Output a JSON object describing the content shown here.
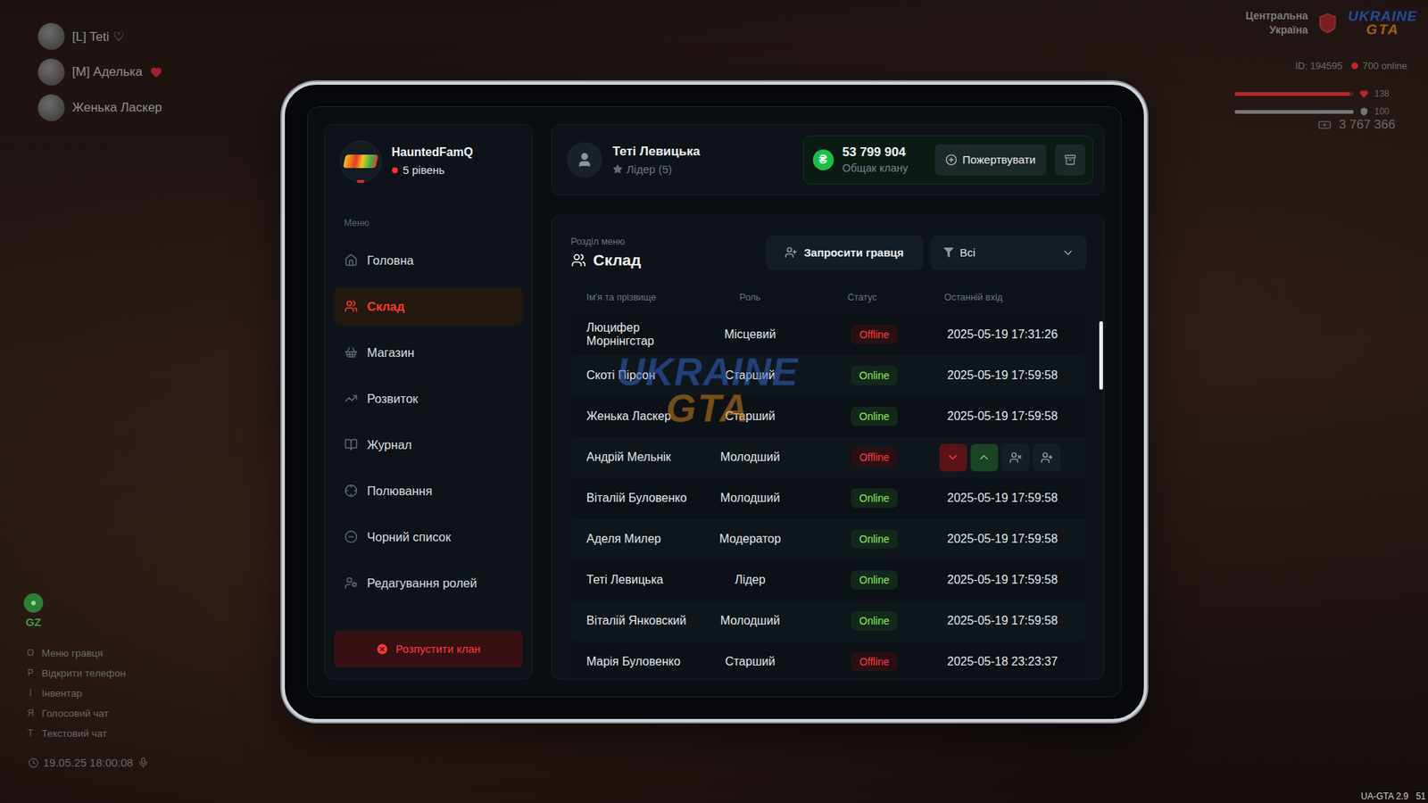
{
  "hud": {
    "players": [
      {
        "name": "[L] Teti",
        "mark": "♡",
        "heart": false
      },
      {
        "name": "[M] Аделька",
        "mark": "",
        "heart": true
      },
      {
        "name": "Женька Ласкер",
        "mark": "",
        "heart": false
      }
    ],
    "region": [
      "Центральна",
      "Україна"
    ],
    "logo": [
      "UKRAINE",
      "GTA"
    ],
    "player_id": "ID: 194595",
    "online": "700 online",
    "bars": [
      {
        "name": "health",
        "value": "138",
        "level": 0.97,
        "color": "#b8252b"
      },
      {
        "name": "armor",
        "value": "100",
        "level": 1,
        "color": "#767676"
      }
    ],
    "money": "3 767 366",
    "zone": "GZ",
    "hints": [
      {
        "key": "O",
        "label": "Меню гравця"
      },
      {
        "key": "P",
        "label": "Відкрити телефон"
      },
      {
        "key": "I",
        "label": "Інвентар"
      },
      {
        "key": "Я",
        "label": "Голосовий чат"
      },
      {
        "key": "T",
        "label": "Текстовий чат"
      }
    ],
    "datetime": "19.05.25 18:00:08",
    "version": "UA-GTA 2.9",
    "fps": "51"
  },
  "tablet": {
    "clan": {
      "name": "HauntedFamQ",
      "level": "5 рівень"
    },
    "menu_label": "Меню",
    "sidebar": {
      "items": [
        {
          "label": "Головна",
          "selected": false
        },
        {
          "label": "Склад",
          "selected": true
        },
        {
          "label": "Магазин",
          "selected": false
        },
        {
          "label": "Розвиток",
          "selected": false
        },
        {
          "label": "Журнал",
          "selected": false
        },
        {
          "label": "Полювання",
          "selected": false
        },
        {
          "label": "Чорний список",
          "selected": false
        },
        {
          "label": "Редагування ролей",
          "selected": false
        }
      ]
    },
    "dissolve_button": "Розпустити клан",
    "user": {
      "name": "Теті Левицька",
      "role": "Лідер (5)"
    },
    "treasury": {
      "currency": "₴",
      "amount": "53 799 904",
      "label": "Общак клану",
      "donate_button": "Пожертвувати"
    },
    "section": {
      "caption": "Розділ меню",
      "title": "Склад"
    },
    "invite_button": "Запросити гравця",
    "filter": {
      "value": "Всі"
    },
    "table": {
      "columns": [
        "Ім'я та прізвище",
        "Роль",
        "Статус",
        "Останній вхід"
      ],
      "rows": [
        {
          "name": "Люцифер Морнінгстар",
          "role": "Місцевий",
          "status": "Offline",
          "online": false,
          "last_login": "2025-05-19 17:31:26",
          "hovered": false
        },
        {
          "name": "Скоті Пірсон",
          "role": "Старший",
          "status": "Online",
          "online": true,
          "last_login": "2025-05-19 17:59:58",
          "hovered": false
        },
        {
          "name": "Женька Ласкер",
          "role": "Старший",
          "status": "Online",
          "online": true,
          "last_login": "2025-05-19 17:59:58",
          "hovered": false
        },
        {
          "name": "Андрій Мельнік",
          "role": "Молодший",
          "status": "Offline",
          "online": false,
          "hovered": true
        },
        {
          "name": "Віталій Буловенко",
          "role": "Молодший",
          "status": "Online",
          "online": true,
          "last_login": "2025-05-19 17:59:58",
          "hovered": false
        },
        {
          "name": "Аделя Милер",
          "role": "Модератор",
          "status": "Online",
          "online": true,
          "last_login": "2025-05-19 17:59:58",
          "hovered": false
        },
        {
          "name": "Теті Левицька",
          "role": "Лідер",
          "status": "Online",
          "online": true,
          "last_login": "2025-05-19 17:59:58",
          "hovered": false
        },
        {
          "name": "Віталій Янковский",
          "role": "Молодший",
          "status": "Online",
          "online": true,
          "last_login": "2025-05-19 17:59:58",
          "hovered": false
        },
        {
          "name": "Марія Буловенко",
          "role": "Старший",
          "status": "Offline",
          "online": false,
          "last_login": "2025-05-18 23:23:37",
          "hovered": false
        }
      ]
    },
    "scrollbar": {
      "level": 0.19
    },
    "watermark": [
      "UKRAINE",
      "GTA"
    ]
  }
}
